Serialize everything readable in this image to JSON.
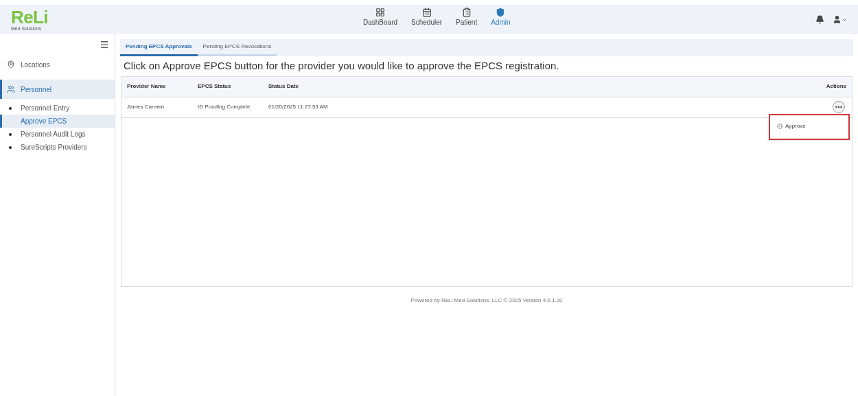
{
  "logo": {
    "text": "ReLi",
    "tagline": "Med Solutions"
  },
  "nav": [
    {
      "label": "DashBoard",
      "kind": "dashboard",
      "selected": false
    },
    {
      "label": "Scheduler",
      "kind": "calendar",
      "selected": false
    },
    {
      "label": "Patient",
      "kind": "patient",
      "selected": false
    },
    {
      "label": "Admin",
      "kind": "shield",
      "selected": true
    }
  ],
  "sidebar": {
    "items": [
      {
        "label": "Locations",
        "kind": "location",
        "selected": false
      },
      {
        "label": "Personnel",
        "kind": "people",
        "selected": true,
        "children": [
          {
            "label": "Personnel Entry",
            "selected": false
          },
          {
            "label": "Approve EPCS",
            "selected": true
          },
          {
            "label": "Personnel Audit Logs",
            "selected": false
          },
          {
            "label": "SureScripts Providers",
            "selected": false
          }
        ]
      }
    ]
  },
  "tabs": [
    {
      "label": "Pending EPCS Approvals",
      "selected": true
    },
    {
      "label": "Pending EPCS Revocations",
      "selected": false
    }
  ],
  "instruction": "Click on Approve EPCS button for the provider you would like to approve the EPCS registration.",
  "table": {
    "columns": [
      "Provider Name",
      "EPCS Status",
      "Status Date",
      "Actions"
    ],
    "rows": [
      [
        "James Carmen",
        "ID Proofing Complete",
        "01/20/2025 11:27:53 AM"
      ]
    ]
  },
  "action_menu": {
    "items": [
      "Approve"
    ],
    "highlighted": true
  },
  "footer": "Powered by ReLi Med Solutions, LLC © 2025 Version 4.0.1.20"
}
